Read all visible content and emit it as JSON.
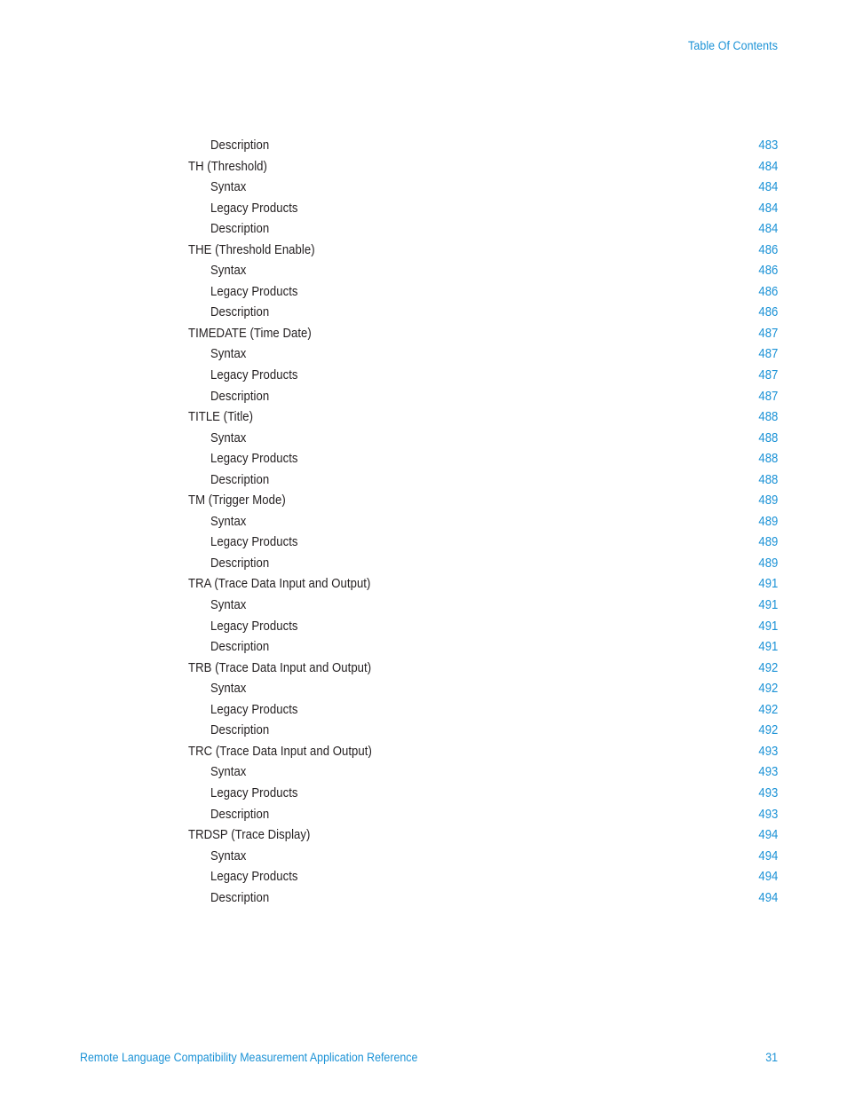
{
  "header": {
    "running_head": "Table Of Contents"
  },
  "colors": {
    "accent_blue": "#1b92d6",
    "body_text": "#231f20",
    "page_background": "#ffffff"
  },
  "toc": {
    "entries": [
      {
        "title": "Description",
        "page": "483",
        "level": 2
      },
      {
        "title": "TH (Threshold)",
        "page": "484",
        "level": 1
      },
      {
        "title": "Syntax",
        "page": "484",
        "level": 2
      },
      {
        "title": "Legacy Products",
        "page": "484",
        "level": 2
      },
      {
        "title": "Description",
        "page": "484",
        "level": 2
      },
      {
        "title": "THE (Threshold Enable)",
        "page": "486",
        "level": 1
      },
      {
        "title": "Syntax",
        "page": "486",
        "level": 2
      },
      {
        "title": "Legacy Products",
        "page": "486",
        "level": 2
      },
      {
        "title": "Description",
        "page": "486",
        "level": 2
      },
      {
        "title": "TIMEDATE (Time Date)",
        "page": "487",
        "level": 1
      },
      {
        "title": "Syntax",
        "page": "487",
        "level": 2
      },
      {
        "title": "Legacy Products",
        "page": "487",
        "level": 2
      },
      {
        "title": "Description",
        "page": "487",
        "level": 2
      },
      {
        "title": "TITLE (Title)",
        "page": "488",
        "level": 1
      },
      {
        "title": "Syntax",
        "page": "488",
        "level": 2
      },
      {
        "title": "Legacy Products",
        "page": "488",
        "level": 2
      },
      {
        "title": "Description",
        "page": "488",
        "level": 2
      },
      {
        "title": "TM (Trigger Mode)",
        "page": "489",
        "level": 1
      },
      {
        "title": "Syntax",
        "page": "489",
        "level": 2
      },
      {
        "title": "Legacy Products",
        "page": "489",
        "level": 2
      },
      {
        "title": "Description",
        "page": "489",
        "level": 2
      },
      {
        "title": "TRA (Trace Data Input and Output)",
        "page": "491",
        "level": 1
      },
      {
        "title": "Syntax",
        "page": "491",
        "level": 2
      },
      {
        "title": "Legacy Products",
        "page": "491",
        "level": 2
      },
      {
        "title": "Description",
        "page": "491",
        "level": 2
      },
      {
        "title": "TRB (Trace Data Input and Output)",
        "page": "492",
        "level": 1
      },
      {
        "title": "Syntax",
        "page": "492",
        "level": 2
      },
      {
        "title": "Legacy Products",
        "page": "492",
        "level": 2
      },
      {
        "title": "Description",
        "page": "492",
        "level": 2
      },
      {
        "title": "TRC (Trace Data Input and Output)",
        "page": "493",
        "level": 1
      },
      {
        "title": "Syntax",
        "page": "493",
        "level": 2
      },
      {
        "title": "Legacy Products",
        "page": "493",
        "level": 2
      },
      {
        "title": "Description",
        "page": "493",
        "level": 2
      },
      {
        "title": "TRDSP (Trace Display)",
        "page": "494",
        "level": 1
      },
      {
        "title": "Syntax",
        "page": "494",
        "level": 2
      },
      {
        "title": "Legacy Products",
        "page": "494",
        "level": 2
      },
      {
        "title": "Description",
        "page": "494",
        "level": 2
      }
    ]
  },
  "footer": {
    "document_title": "Remote Language Compatibility Measurement Application Reference",
    "page_number": "31"
  }
}
